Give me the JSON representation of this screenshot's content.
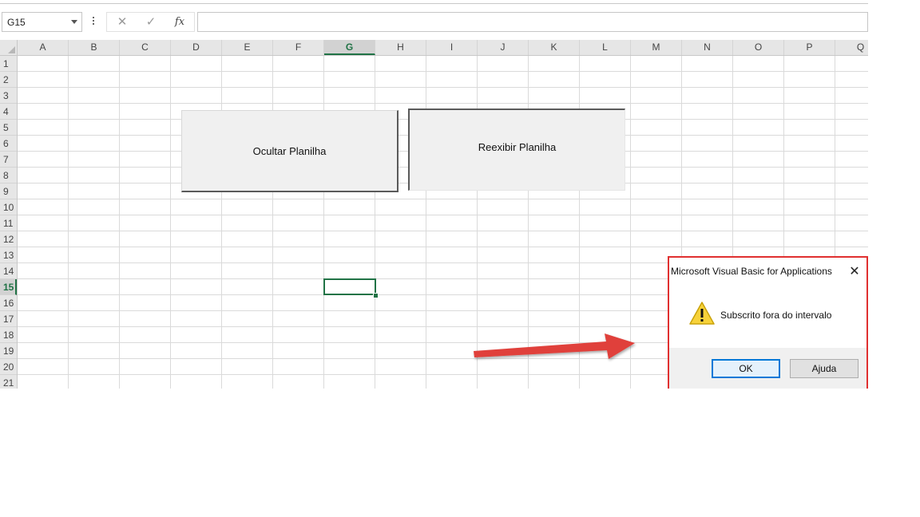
{
  "formula_bar": {
    "name_box": "G15",
    "cancel_symbol": "✕",
    "enter_symbol": "✓",
    "fx_symbol": "fx",
    "formula_value": ""
  },
  "columns": [
    "A",
    "B",
    "C",
    "D",
    "E",
    "F",
    "G",
    "H",
    "I",
    "J",
    "K",
    "L",
    "M",
    "N",
    "O",
    "P",
    "Q"
  ],
  "rows": [
    "1",
    "2",
    "3",
    "4",
    "5",
    "6",
    "7",
    "8",
    "9",
    "10",
    "11",
    "12",
    "13",
    "14",
    "15",
    "16",
    "17",
    "18",
    "19",
    "20",
    "21"
  ],
  "selected": {
    "column": "G",
    "row": "15"
  },
  "sheet_buttons": {
    "ocultar": "Ocultar Planilha",
    "reexibir": "Reexibir  Planilha"
  },
  "dialog": {
    "title": "Microsoft Visual Basic for Applications",
    "message": "Subscrito fora do intervalo",
    "ok_label": "OK",
    "help_label": "Ajuda",
    "icon": "warning-icon"
  },
  "colors": {
    "excel_green": "#217346",
    "highlight_red": "#e03030",
    "arrow_red": "#e0403a"
  }
}
